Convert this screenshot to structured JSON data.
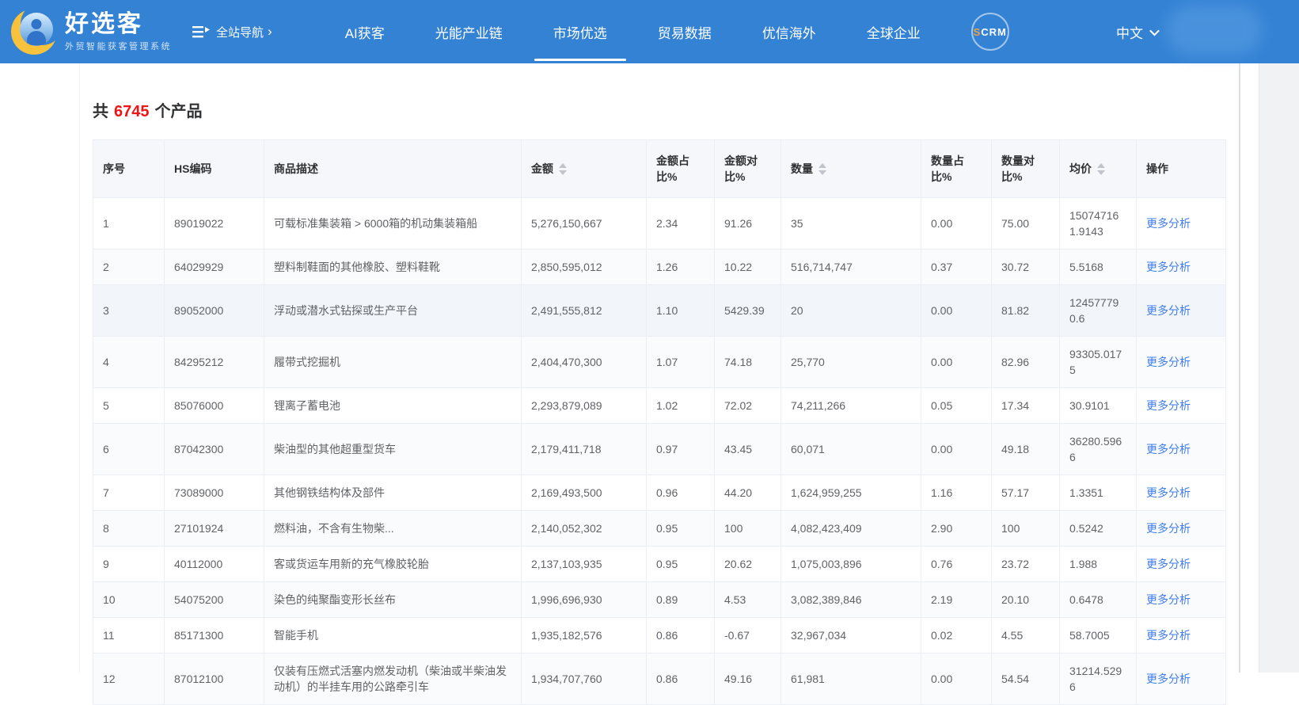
{
  "header": {
    "logo": {
      "title": "好选客",
      "subtitle": "外贸智能获客管理系统"
    },
    "site_nav_label": "全站导航",
    "nav_items": [
      {
        "label": "AI获客",
        "active": false,
        "scrm": false
      },
      {
        "label": "光能产业链",
        "active": false,
        "scrm": false
      },
      {
        "label": "市场优选",
        "active": true,
        "scrm": false
      },
      {
        "label": "贸易数据",
        "active": false,
        "scrm": false
      },
      {
        "label": "优信海外",
        "active": false,
        "scrm": false
      },
      {
        "label": "全球企业",
        "active": false,
        "scrm": false
      },
      {
        "label": "SCRM",
        "active": false,
        "scrm": true
      }
    ],
    "language": {
      "label": "中文"
    }
  },
  "summary": {
    "prefix": "共",
    "count": "6745",
    "suffix": "个产品"
  },
  "table": {
    "columns": [
      {
        "label": "序号",
        "sortable": false
      },
      {
        "label": "HS编码",
        "sortable": false
      },
      {
        "label": "商品描述",
        "sortable": false
      },
      {
        "label": "金额",
        "sortable": true
      },
      {
        "label": "金额占比%",
        "sortable": false
      },
      {
        "label": "金额对比%",
        "sortable": false
      },
      {
        "label": "数量",
        "sortable": true
      },
      {
        "label": "数量占比%",
        "sortable": false
      },
      {
        "label": "数量对比%",
        "sortable": false
      },
      {
        "label": "均价",
        "sortable": true
      },
      {
        "label": "操作",
        "sortable": false
      }
    ],
    "action_label": "更多分析",
    "rows": [
      {
        "index": "1",
        "hs_code": "89019022",
        "description": "可载标准集装箱 > 6000箱的机动集装箱船",
        "amount": "5,276,150,667",
        "amount_share_pct": "2.34",
        "amount_yoy_pct": "91.26",
        "quantity": "35",
        "quantity_share_pct": "0.00",
        "quantity_yoy_pct": "75.00",
        "avg_price": "150747161.9143"
      },
      {
        "index": "2",
        "hs_code": "64029929",
        "description": "塑料制鞋面的其他橡胶、塑料鞋靴",
        "amount": "2,850,595,012",
        "amount_share_pct": "1.26",
        "amount_yoy_pct": "10.22",
        "quantity": "516,714,747",
        "quantity_share_pct": "0.37",
        "quantity_yoy_pct": "30.72",
        "avg_price": "5.5168"
      },
      {
        "index": "3",
        "hs_code": "89052000",
        "description": "浮动或潜水式钻探或生产平台",
        "amount": "2,491,555,812",
        "amount_share_pct": "1.10",
        "amount_yoy_pct": "5429.39",
        "quantity": "20",
        "quantity_share_pct": "0.00",
        "quantity_yoy_pct": "81.82",
        "avg_price": "124577790.6"
      },
      {
        "index": "4",
        "hs_code": "84295212",
        "description": "履带式挖掘机",
        "amount": "2,404,470,300",
        "amount_share_pct": "1.07",
        "amount_yoy_pct": "74.18",
        "quantity": "25,770",
        "quantity_share_pct": "0.00",
        "quantity_yoy_pct": "82.96",
        "avg_price": "93305.0175"
      },
      {
        "index": "5",
        "hs_code": "85076000",
        "description": "锂离子蓄电池",
        "amount": "2,293,879,089",
        "amount_share_pct": "1.02",
        "amount_yoy_pct": "72.02",
        "quantity": "74,211,266",
        "quantity_share_pct": "0.05",
        "quantity_yoy_pct": "17.34",
        "avg_price": "30.9101"
      },
      {
        "index": "6",
        "hs_code": "87042300",
        "description": "柴油型的其他超重型货车",
        "amount": "2,179,411,718",
        "amount_share_pct": "0.97",
        "amount_yoy_pct": "43.45",
        "quantity": "60,071",
        "quantity_share_pct": "0.00",
        "quantity_yoy_pct": "49.18",
        "avg_price": "36280.5966"
      },
      {
        "index": "7",
        "hs_code": "73089000",
        "description": "其他钢铁结构体及部件",
        "amount": "2,169,493,500",
        "amount_share_pct": "0.96",
        "amount_yoy_pct": "44.20",
        "quantity": "1,624,959,255",
        "quantity_share_pct": "1.16",
        "quantity_yoy_pct": "57.17",
        "avg_price": "1.3351"
      },
      {
        "index": "8",
        "hs_code": "27101924",
        "description": "燃料油，不含有生物柴...",
        "amount": "2,140,052,302",
        "amount_share_pct": "0.95",
        "amount_yoy_pct": "100",
        "quantity": "4,082,423,409",
        "quantity_share_pct": "2.90",
        "quantity_yoy_pct": "100",
        "avg_price": "0.5242"
      },
      {
        "index": "9",
        "hs_code": "40112000",
        "description": "客或货运车用新的充气橡胶轮胎",
        "amount": "2,137,103,935",
        "amount_share_pct": "0.95",
        "amount_yoy_pct": "20.62",
        "quantity": "1,075,003,896",
        "quantity_share_pct": "0.76",
        "quantity_yoy_pct": "23.72",
        "avg_price": "1.988"
      },
      {
        "index": "10",
        "hs_code": "54075200",
        "description": "染色的纯聚酯变形长丝布",
        "amount": "1,996,696,930",
        "amount_share_pct": "0.89",
        "amount_yoy_pct": "4.53",
        "quantity": "3,082,389,846",
        "quantity_share_pct": "2.19",
        "quantity_yoy_pct": "20.10",
        "avg_price": "0.6478"
      },
      {
        "index": "11",
        "hs_code": "85171300",
        "description": "智能手机",
        "amount": "1,935,182,576",
        "amount_share_pct": "0.86",
        "amount_yoy_pct": "-0.67",
        "quantity": "32,967,034",
        "quantity_share_pct": "0.02",
        "quantity_yoy_pct": "4.55",
        "avg_price": "58.7005"
      },
      {
        "index": "12",
        "hs_code": "87012100",
        "description": "仅装有压燃式活塞内燃发动机（柴油或半柴油发动机）的半挂车用的公路牵引车",
        "amount": "1,934,707,760",
        "amount_share_pct": "0.86",
        "amount_yoy_pct": "49.16",
        "quantity": "61,981",
        "quantity_share_pct": "0.00",
        "quantity_yoy_pct": "54.54",
        "avg_price": "31214.5296"
      }
    ]
  },
  "colors": {
    "header_blue": "#3482d4",
    "count_red": "#f01414",
    "link_blue": "#3e7cf0"
  }
}
